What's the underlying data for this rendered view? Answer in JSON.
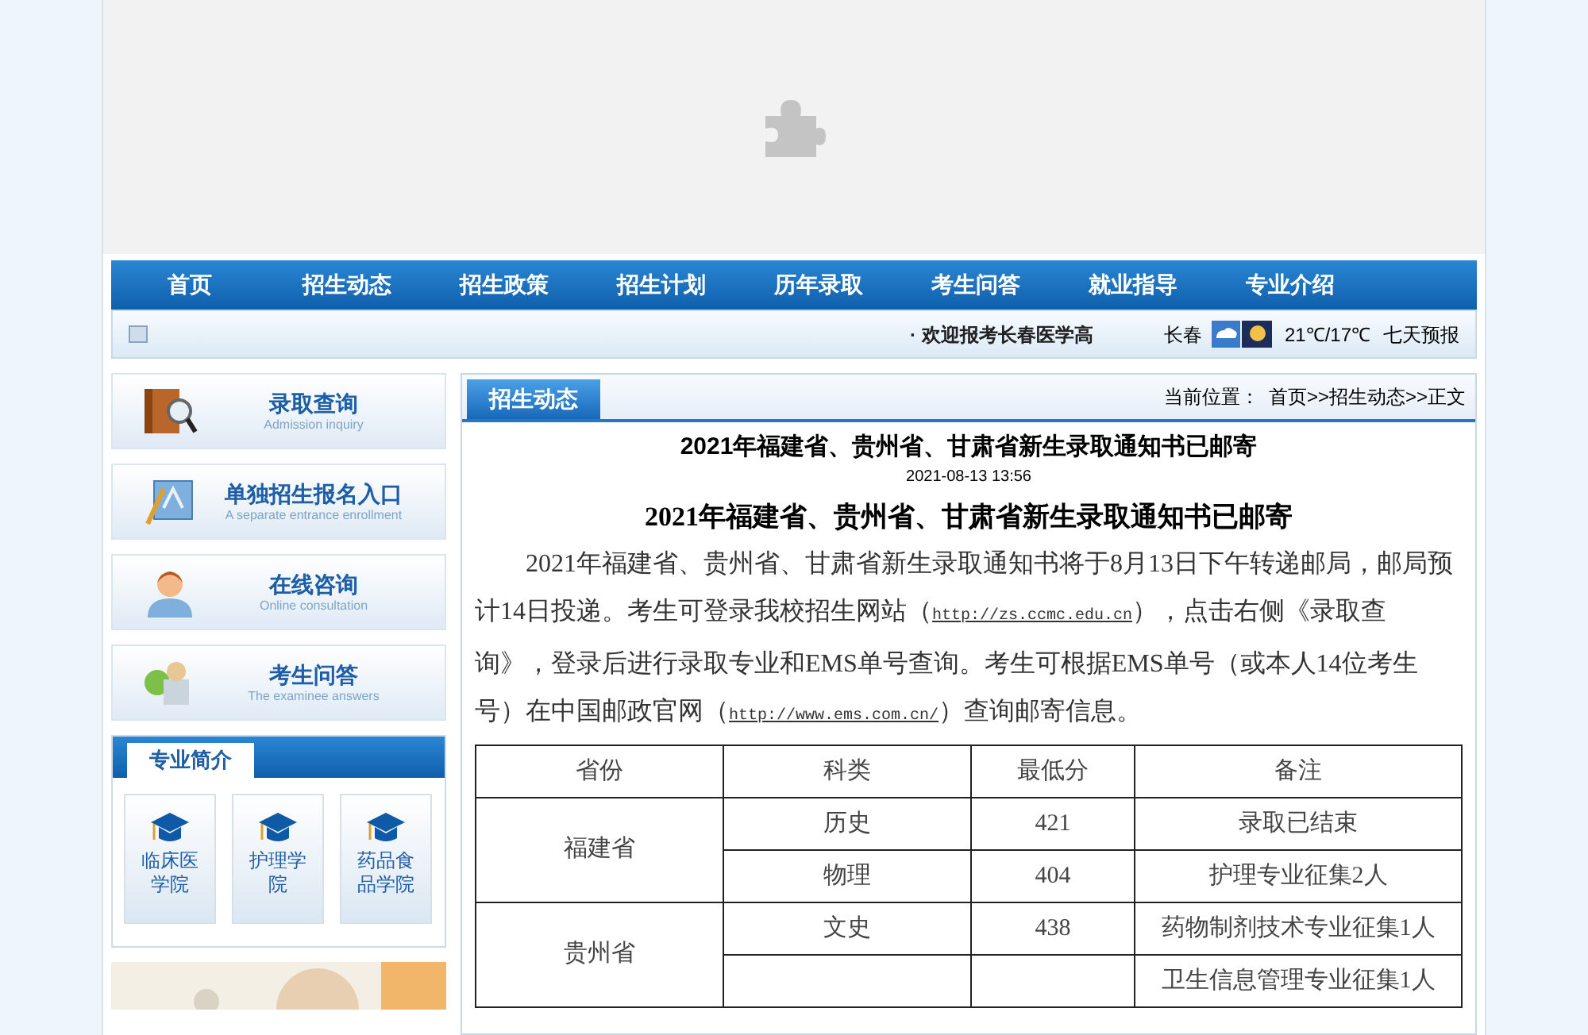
{
  "nav": [
    {
      "label": "首页"
    },
    {
      "label": "招生动态"
    },
    {
      "label": "招生政策"
    },
    {
      "label": "招生计划"
    },
    {
      "label": "历年录取"
    },
    {
      "label": "考生问答"
    },
    {
      "label": "就业指导"
    },
    {
      "label": "专业介绍"
    }
  ],
  "ticker": {
    "bullet": "·",
    "text": "欢迎报考长春医学高",
    "city": "长春",
    "temperature": "21℃/17℃",
    "forecast_link": "七天预报"
  },
  "quick_links": [
    {
      "kind": "search",
      "title": "录取查询",
      "subtitle": "Admission inquiry"
    },
    {
      "kind": "form",
      "title": "单独招生报名入口",
      "subtitle": "A separate entrance enrollment"
    },
    {
      "kind": "support",
      "title": "在线咨询",
      "subtitle": "Online consultation"
    },
    {
      "kind": "qa",
      "title": "考生问答",
      "subtitle": "The examinee answers"
    }
  ],
  "majors": {
    "title": "专业简介",
    "items": [
      {
        "label": "临床医学院"
      },
      {
        "label": "护理学院"
      },
      {
        "label": "药品食品学院"
      }
    ]
  },
  "article": {
    "tab": "招生动态",
    "breadcrumb_label": "当前位置：",
    "breadcrumb": "首页>>招生动态>>正文",
    "title": "2021年福建省、贵州省、甘肃省新生录取通知书已邮寄",
    "date": "2021-08-13 13:56",
    "heading": "2021年福建省、贵州省、甘肃省新生录取通知书已邮寄",
    "paragraph": [
      {
        "kind": "text",
        "text": "2021年福建省、贵州省、甘肃省新生录取通知书将于8月13日下午转递邮局，邮局预计14日投递。考生可登录我校招生网站（"
      },
      {
        "kind": "link",
        "text": "http://zs.ccmc.edu.cn"
      },
      {
        "kind": "text",
        "text": "），点击右侧《录取查询》，登录后进行录取专业和EMS单号查询。考生可根据EMS单号（或本人14位考生号）在中国邮政官网（"
      },
      {
        "kind": "link",
        "text": "http://www.ems.com.cn/"
      },
      {
        "kind": "text",
        "text": "）查询邮寄信息。"
      }
    ],
    "table": {
      "columns": [
        "省份",
        "科类",
        "最低分",
        "备注"
      ],
      "groups": [
        {
          "province": "福建省",
          "rows": [
            {
              "subject": "历史",
              "min_score": "421",
              "note": "录取已结束"
            },
            {
              "subject": "物理",
              "min_score": "404",
              "note": "护理专业征集2人"
            }
          ]
        },
        {
          "province": "贵州省",
          "rows": [
            {
              "subject": "文史",
              "min_score": "438",
              "note": "药物制剂技术专业征集1人"
            },
            {
              "note": "卫生信息管理专业征集1人"
            }
          ]
        }
      ]
    }
  }
}
